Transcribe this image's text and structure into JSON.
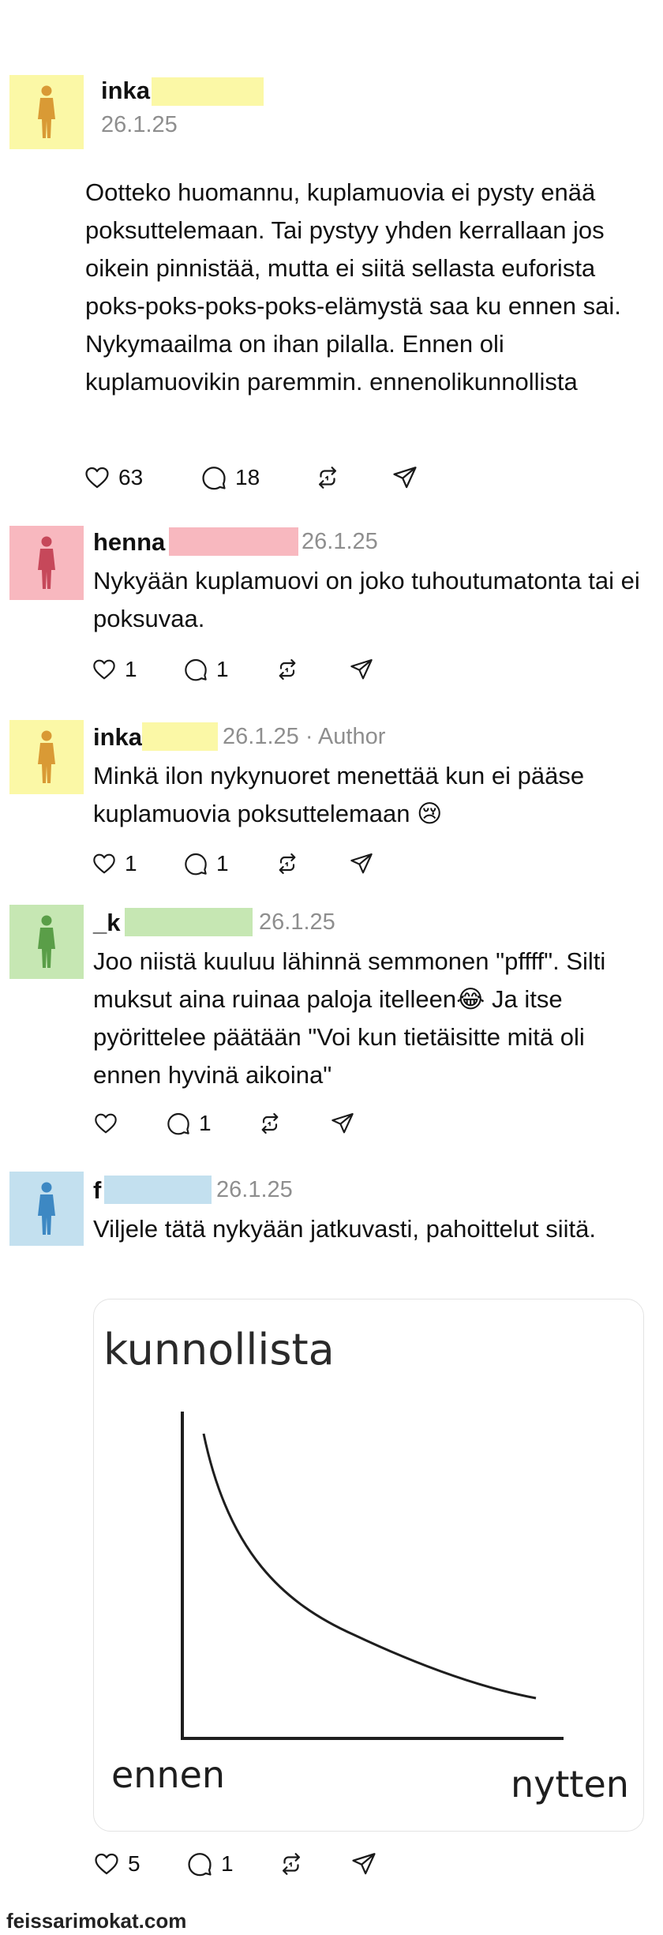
{
  "colors": {
    "avatar_yellow": "#fbf8a6",
    "avatar_pink": "#f8b8bf",
    "avatar_green": "#c6e7b3",
    "avatar_blue": "#c3e0ef",
    "figure_orange": "#d99a35",
    "figure_red": "#c6485a",
    "figure_green": "#5a9e48",
    "figure_blue": "#3d88c3"
  },
  "main_post": {
    "author": "inka",
    "date": "26.1.25",
    "text": "Ootteko huomannu, kuplamuovia ei pysty enää poksuttelemaan. Tai pystyy yhden kerrallaan jos oikein pinnistää, mutta ei siitä sellasta euforista poks-poks-poks-poks-elämystä saa ku ennen sai. Nykymaailma on ihan pilalla. Ennen oli kuplamuovikin paremmin. ennenolikunnollista",
    "likes": "63",
    "replies": "18"
  },
  "replies": [
    {
      "author": "henna",
      "date": "26.1.25",
      "text": "Nykyään kuplamuovi on joko tuhoutumatonta tai ei poksuvaa.",
      "likes": "1",
      "replies": "1"
    },
    {
      "author": "inka",
      "date": "26.1.25 · Author",
      "text": "Minkä ilon nykynuoret menettää kun ei pääse kuplamuovia poksuttelemaan 😢",
      "likes": "1",
      "replies": "1"
    },
    {
      "author": "_k",
      "date": "26.1.25",
      "text": "Joo niistä kuuluu lähinnä semmonen \"pffff\". Silti muksut aina ruinaa paloja itelleen😂 Ja itse pyörittelee päätään \"Voi kun tietäisitte mitä oli ennen hyvinä aikoina\"",
      "likes": "",
      "replies": "1"
    },
    {
      "author": "f",
      "date": "26.1.25",
      "text": "Viljele tätä nykyään jatkuvasti, pahoittelut siitä.",
      "likes": "5",
      "replies": "1"
    }
  ],
  "meme": {
    "title": "kunnollista",
    "x_left": "ennen",
    "x_right": "nytten"
  },
  "watermark": "feissarimokat.com",
  "icons": {
    "like": "heart-icon",
    "reply": "comment-icon",
    "repost": "repost-icon",
    "share": "send-icon",
    "avatar": "person-figure-icon"
  }
}
